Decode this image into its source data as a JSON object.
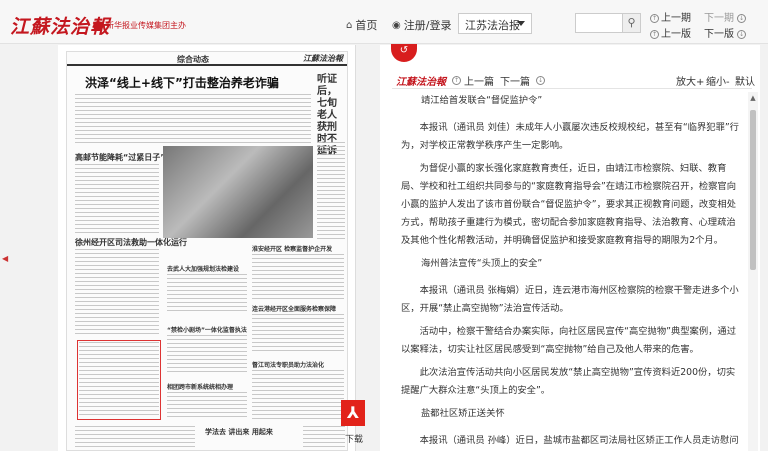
{
  "header": {
    "logo": "江蘇法治報",
    "publisher": "新华报业传媒集团主办",
    "home": "首页",
    "login": "注册/登录",
    "paper": "江苏法治报",
    "search_placeholder": "",
    "prev_issue": "上一期",
    "next_issue": "下一期",
    "prev_page": "上一版",
    "next_page": "下一版"
  },
  "page_image": {
    "section": "综合动态",
    "brand": "江蘇法治報",
    "headline": "洪泽“线上+线下”打击整治养老诈骗",
    "side_headline": "听证后，七旬老人获刑时不延诉",
    "headline2": "高邮节能降耗“过紧日子”",
    "headline3": "徐州经开区司法救助一体化运行",
    "mid1": "淮安经开区 检察监督护企开发",
    "mid2": "去武人大加强规划法检建设",
    "mid3": "连云港经开区全面服务检察保障",
    "mid4": "“禁检小剧场”一体化监督执法",
    "mid5": "督江司法专职员助力法治化",
    "mid6": "相团跨市新系统统相办理",
    "bottom": "学法去 讲出来 用起来"
  },
  "download": {
    "icon": "pdf-icon",
    "label": "下载"
  },
  "article": {
    "logo": "江蘇法治報",
    "prev": "上一篇",
    "next": "下一篇",
    "zoom_in": "放大+",
    "zoom_out": "缩小-",
    "default": "默认",
    "paragraphs": [
      {
        "heading": true,
        "text": "靖江给首发联合“督促监护令”"
      },
      {
        "heading": false,
        "text": "本报讯（通讯员 刘佳）未成年人小赢屡次违反校规校纪，甚至有“临界犯罪”行为，对学校正常教学秩序产生一定影响。"
      },
      {
        "heading": false,
        "text": "为督促小赢的家长强化家庭教育责任，近日，由靖江市检察院、妇联、教育局、学校和社工组织共同参与的“家庭教育指导会”在靖江市检察院召开，检察官向小赢的监护人发出了该市首份联合“督促监护令”，要求其正视教育问题，改变相处方式，帮助孩子重建行为模式，密切配合参加家庭教育指导、法治教育、心理疏治及其他个性化帮教活动，并明确督促监护和接受家庭教育指导的期限为2个月。"
      },
      {
        "heading": true,
        "text": "海州普法宣传“头顶上的安全”"
      },
      {
        "heading": false,
        "text": "本报讯（通讯员 张梅娟）近日，连云港市海州区检察院的检察干警走进多个小区，开展“禁止高空抛物”法治宣传活动。"
      },
      {
        "heading": false,
        "text": "活动中，检察干警结合办案实际，向社区居民宣传“高空抛物”典型案例，通过以案释法，切实让社区居民感受到“高空抛物”给自己及他人带来的危害。"
      },
      {
        "heading": false,
        "text": "此次法治宣传活动共向小区居民发放“禁止高空抛物”宣传资料近200份，切实提醒广大群众注意“头顶上的安全”。"
      },
      {
        "heading": true,
        "text": "盐都社区矫正送关怀"
      },
      {
        "heading": false,
        "text": "本报讯（通讯员 孙峰）近日，盐城市盐都区司法局社区矫正工作人员走访慰问社区矫正对象。"
      }
    ]
  },
  "colors": {
    "brand_red": "#c4171f",
    "pdf_red": "#e2231a"
  }
}
